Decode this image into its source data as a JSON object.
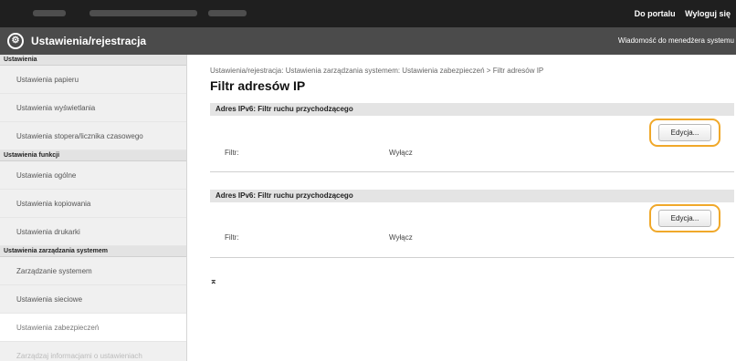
{
  "topbar": {
    "portal_link": "Do portalu",
    "logout_link": "Wyloguj się"
  },
  "header": {
    "logo_glyph": "⚙",
    "title": "Ustawienia/rejestracja",
    "message_link": "Wiadomość do menedżera systemu"
  },
  "sidebar": {
    "sections": [
      {
        "label": "Ustawienia",
        "items": [
          "Ustawienia papieru",
          "Ustawienia wyświetlania",
          "Ustawienia stopera/licznika czasowego"
        ]
      },
      {
        "label": "Ustawienia funkcji",
        "items": [
          "Ustawienia ogólne",
          "Ustawienia kopiowania",
          "Ustawienia drukarki"
        ]
      },
      {
        "label": "Ustawienia zarządzania systemem",
        "items": [
          "Zarządzanie systemem",
          "Ustawienia sieciowe",
          "Ustawienia zabezpieczeń",
          "Zarządzaj informacjami o ustawieniach"
        ]
      }
    ]
  },
  "main": {
    "breadcrumb": "Ustawienia/rejestracja: Ustawienia zarządzania systemem: Ustawienia zabezpieczeń > Filtr adresów IP",
    "title": "Filtr adresów IP",
    "sections": [
      {
        "header": "Adres IPv6: Filtr ruchu przychodzącego",
        "edit_label": "Edycja...",
        "field_label": "Filtr:",
        "field_value": "Wyłącz"
      },
      {
        "header": "Adres IPv6: Filtr ruchu przychodzącego",
        "edit_label": "Edycja...",
        "field_label": "Filtr:",
        "field_value": "Wyłącz"
      }
    ],
    "to_top_glyph": "⌅"
  },
  "colors": {
    "topbar_bg": "#1f1f1f",
    "titlebar_bg": "#4b4b4b",
    "highlight": "#f0a82a"
  }
}
